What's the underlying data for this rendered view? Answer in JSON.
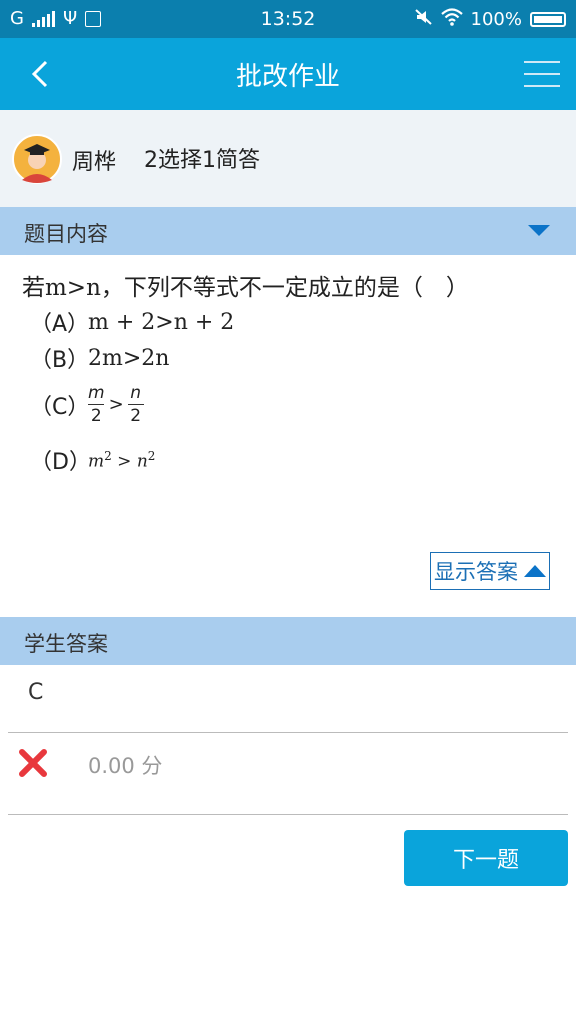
{
  "status_bar": {
    "network": "G",
    "time": "13:52",
    "battery": "100%"
  },
  "nav": {
    "title": "批改作业",
    "back_icon": "chevron-left-icon",
    "menu_icon": "hamburger-menu-icon"
  },
  "user": {
    "name": "周桦",
    "task": "2选择1简答"
  },
  "question_section": {
    "header": "题目内容",
    "stem": "若m>n，下列不等式不一定成立的是（　）",
    "options": {
      "a": {
        "tag": "（A）",
        "text": "m + 2>n + 2"
      },
      "b": {
        "tag": "（B）",
        "text": "2m>2n"
      },
      "c": {
        "tag": "（C）",
        "left_num": "m",
        "left_den": "2",
        "op": ">",
        "right_num": "n",
        "right_den": "2"
      },
      "d": {
        "tag": "（D）",
        "base1": "m",
        "exp1": "2",
        "op": " > ",
        "base2": "n",
        "exp2": "2"
      }
    },
    "show_answer_label": "显示答案"
  },
  "answer_section": {
    "header": "学生答案",
    "student_answer": "C",
    "score": "0.00 分",
    "result_icon": "wrong-x-icon"
  },
  "next_button": "下一题",
  "colors": {
    "status_bar": "#0b7fae",
    "nav_bar": "#0aa4db",
    "section_header": "#a9cdee",
    "accent_blue": "#1b6fb5",
    "wrong_red": "#e8383d"
  }
}
